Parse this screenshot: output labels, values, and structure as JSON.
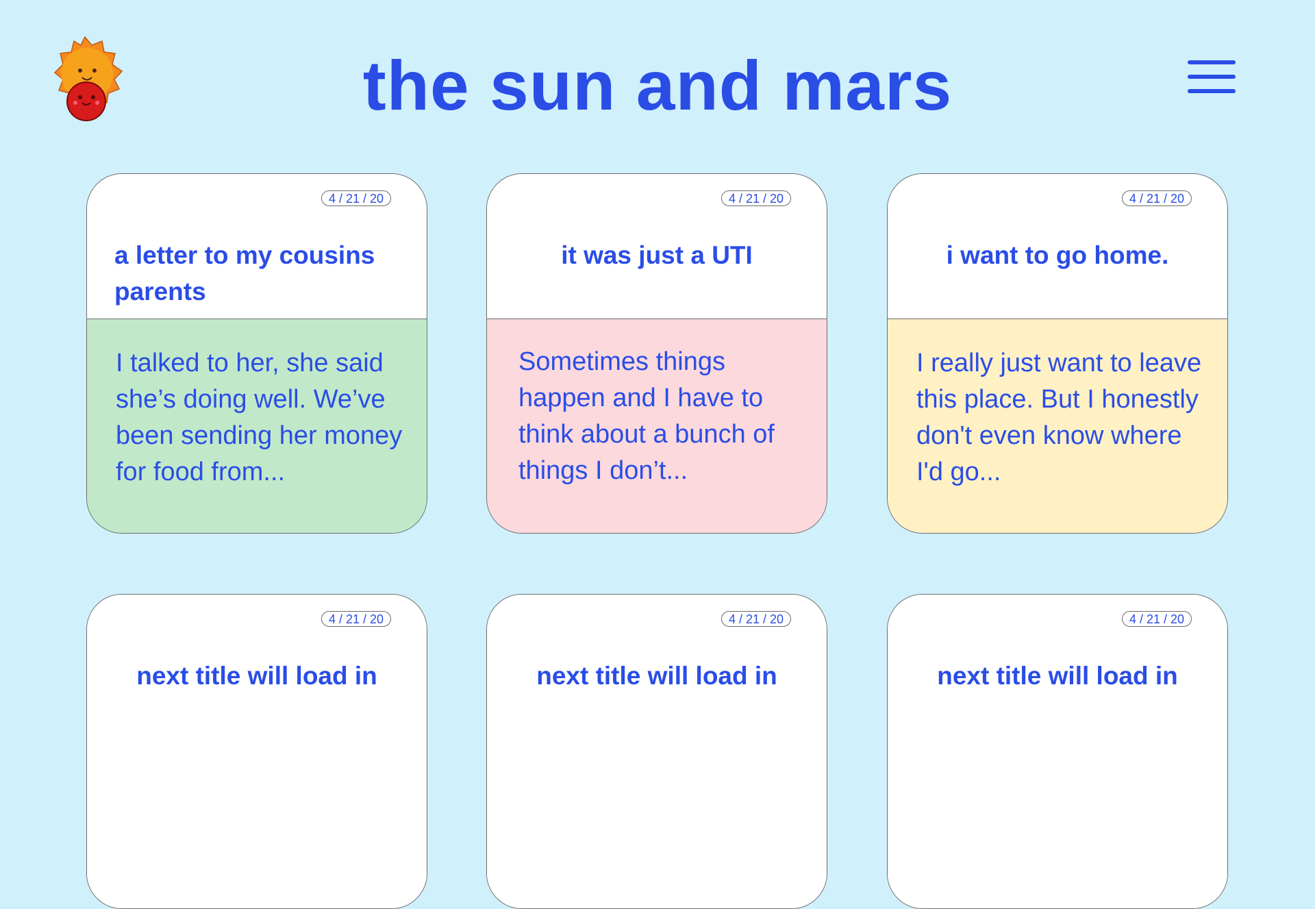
{
  "header": {
    "title": "the sun and mars",
    "logo_icon": "sun-and-mars-logo-icon",
    "menu_icon": "hamburger-menu-icon"
  },
  "colors": {
    "background": "#d0f0fc",
    "accent_text": "#2a4de6",
    "card_green": "#c1e9c9",
    "card_pink": "#fcd9dc",
    "card_yellow": "#fff1c4"
  },
  "cards": [
    {
      "date": "4 / 21 / 20",
      "title": "a letter to my cousins parents",
      "excerpt": "I talked to her, she said she’s doing well. We’ve been sending her money for food from..."
    },
    {
      "date": "4 / 21 / 20",
      "title": "it was just a UTI",
      "excerpt": "Sometimes things happen and I have to think about a bunch of things I don’t..."
    },
    {
      "date": "4 / 21 / 20",
      "title": "i want to go home.",
      "excerpt": "I really just want to leave this place. But I honestly don't even know where I'd go..."
    },
    {
      "date": "4 / 21 / 20",
      "title": "next title will load in"
    },
    {
      "date": "4 / 21 / 20",
      "title": "next title will load in"
    },
    {
      "date": "4 / 21 / 20",
      "title": "next title will load in"
    }
  ]
}
